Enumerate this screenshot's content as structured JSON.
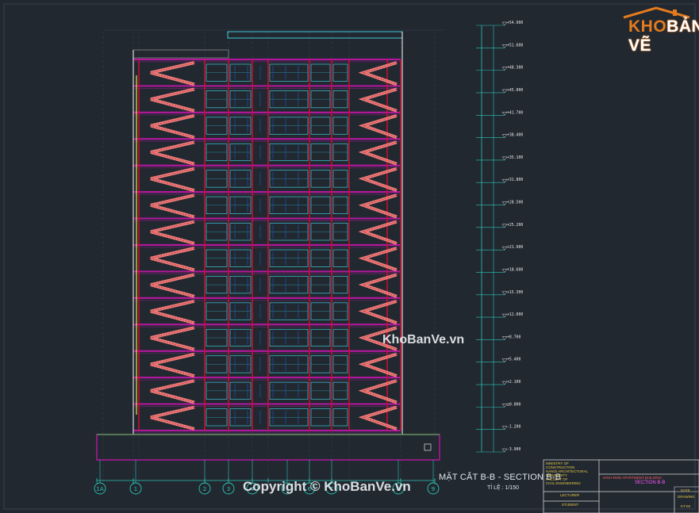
{
  "drawing": {
    "title": "MẶT CẮT B-B - SECTION B-B",
    "scale": "TỈ LỆ : 1/150",
    "grid_axes": [
      "1A",
      "1",
      "2",
      "3",
      "4",
      "5",
      "6",
      "7",
      "8",
      "9"
    ],
    "levels": [
      "+54.900",
      "+51.600",
      "+48.300",
      "+45.000",
      "+41.700",
      "+38.400",
      "+35.100",
      "+31.800",
      "+28.500",
      "+25.200",
      "+21.900",
      "+18.600",
      "+15.300",
      "+12.000",
      "+8.700",
      "+5.400",
      "+2.100",
      "±0.000",
      "-1.200",
      "-3.900"
    ],
    "floor_count": 14,
    "colors": {
      "background": "#212830",
      "structure": "#c8102e",
      "slab": "#b0179a",
      "stairs": "#f07c7c",
      "windows": "#3fc8d8",
      "dimension": "#2ec4b6",
      "title_block": "#e8c84a"
    }
  },
  "logo": {
    "part1": "KHO",
    "part2": "BẢN VẼ"
  },
  "watermarks": {
    "center": "KhoBanVe.vn",
    "bottom": "Copyright © KhoBanVe.vn"
  },
  "title_block": {
    "company_lines": [
      "MINISTRY OF CONSTRUCTION",
      "HANOI ARCHITECTURAL",
      "UNIVERSITY",
      "FACULTY OF",
      "CIVIL ENGINEERING"
    ],
    "project": "HIGH-RISE APARTMENT BUILDING",
    "sheet_title": "SECTION B-B",
    "lecturer": "LECTURER",
    "student": "STUDENT",
    "date": "DATE",
    "drawing_no": "DRAWING",
    "kt": "KT-03"
  }
}
